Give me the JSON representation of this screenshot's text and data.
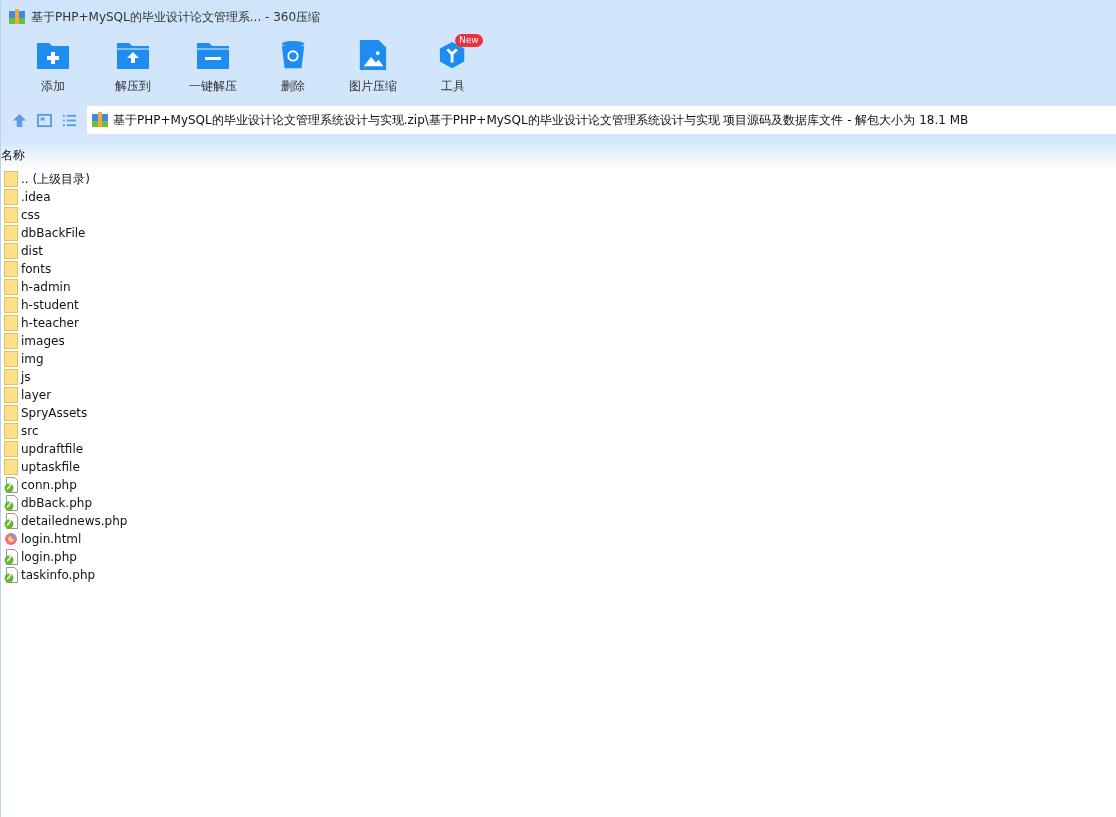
{
  "window": {
    "title": "基于PHP+MySQL的毕业设计论文管理系... - 360压缩"
  },
  "toolbar": [
    {
      "kind": "add",
      "label": "添加"
    },
    {
      "kind": "extract-to",
      "label": "解压到"
    },
    {
      "kind": "extract",
      "label": "一键解压"
    },
    {
      "kind": "delete",
      "label": "删除"
    },
    {
      "kind": "image",
      "label": "图片压缩"
    },
    {
      "kind": "tools",
      "label": "工具",
      "badge": "New"
    }
  ],
  "address": {
    "path": "基于PHP+MySQL的毕业设计论文管理系统设计与实现.zip\\基于PHP+MySQL的毕业设计论文管理系统设计与实现 项目源码及数据库文件 - 解包大小为 18.1 MB"
  },
  "table": {
    "columns": [
      "名称"
    ],
    "rows": [
      {
        "kind": "folder",
        "name": ".. (上级目录)"
      },
      {
        "kind": "folder",
        "name": ".idea"
      },
      {
        "kind": "folder",
        "name": "css"
      },
      {
        "kind": "folder",
        "name": "dbBackFile"
      },
      {
        "kind": "folder",
        "name": "dist"
      },
      {
        "kind": "folder",
        "name": "fonts"
      },
      {
        "kind": "folder",
        "name": "h-admin"
      },
      {
        "kind": "folder",
        "name": "h-student"
      },
      {
        "kind": "folder",
        "name": "h-teacher"
      },
      {
        "kind": "folder",
        "name": "images"
      },
      {
        "kind": "folder",
        "name": "img"
      },
      {
        "kind": "folder",
        "name": "js"
      },
      {
        "kind": "folder",
        "name": "layer"
      },
      {
        "kind": "folder",
        "name": "SpryAssets"
      },
      {
        "kind": "folder",
        "name": "src"
      },
      {
        "kind": "folder",
        "name": "updraftfile"
      },
      {
        "kind": "folder",
        "name": "uptaskfile"
      },
      {
        "kind": "php",
        "name": "conn.php"
      },
      {
        "kind": "php",
        "name": "dbBack.php"
      },
      {
        "kind": "php",
        "name": "detailednews.php"
      },
      {
        "kind": "html",
        "name": "login.html"
      },
      {
        "kind": "php",
        "name": "login.php"
      },
      {
        "kind": "php",
        "name": "taskinfo.php"
      }
    ]
  }
}
